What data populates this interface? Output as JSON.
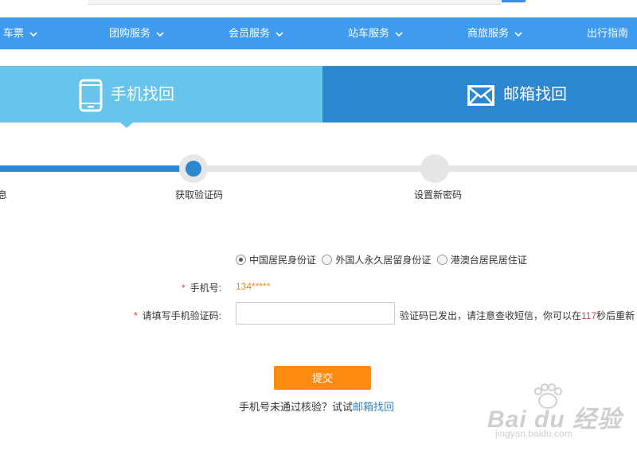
{
  "nav": {
    "items": [
      {
        "label": "车票"
      },
      {
        "label": "团购服务"
      },
      {
        "label": "会员服务"
      },
      {
        "label": "站车服务"
      },
      {
        "label": "商旅服务"
      },
      {
        "label": "出行指南"
      }
    ]
  },
  "tabs": {
    "phone": {
      "label": "手机找回",
      "icon": "phone-icon",
      "active": true
    },
    "email": {
      "label": "邮箱找回",
      "icon": "envelope-icon",
      "active": false
    }
  },
  "steps": {
    "items": [
      {
        "label": "息",
        "state": "done"
      },
      {
        "label": "获取验证码",
        "state": "current"
      },
      {
        "label": "设置新密码",
        "state": "todo"
      }
    ]
  },
  "form": {
    "id_types": [
      {
        "label": "中国居民身份证",
        "checked": true
      },
      {
        "label": "外国人永久居留身份证",
        "checked": false
      },
      {
        "label": "港澳台居民居住证",
        "checked": false
      }
    ],
    "required_mark": "*",
    "phone_label": "手机号:",
    "phone_value": "134*****",
    "code_label": "请填写手机验证码:",
    "code_value": "",
    "code_hint_before": "验证码已发出，请注意查收短信，你可以在",
    "code_hint_seconds": "117",
    "code_hint_after": "秒后重新",
    "submit_label": "提交",
    "alt_text": "手机号未通过核验？试试",
    "alt_link": "邮箱找回"
  },
  "watermark": {
    "brand": "Bai du 经验",
    "url": "jingyan.baidu.com"
  },
  "colors": {
    "nav_bg": "#3e9bf0",
    "tab_active": "#67c4ea",
    "tab_inactive": "#2b88cf",
    "progress": "#2b88cf",
    "submit": "#ff8a12",
    "phone_value": "#f08a27",
    "required": "#e4393c"
  }
}
